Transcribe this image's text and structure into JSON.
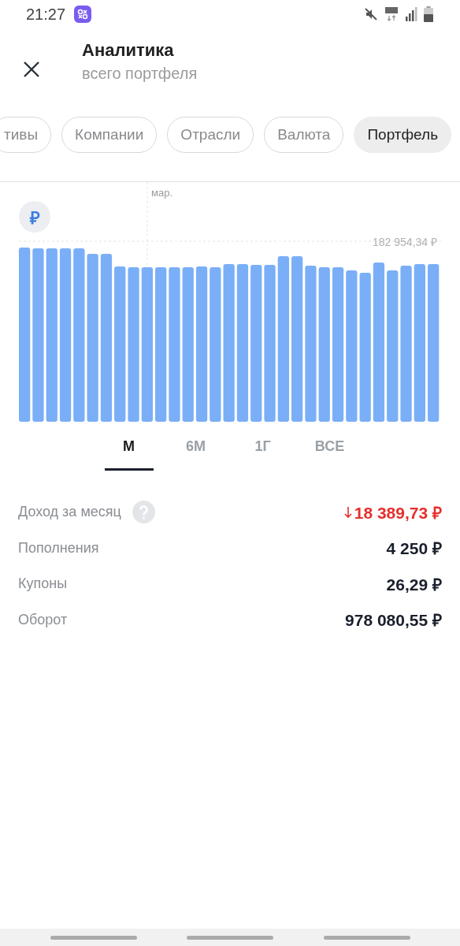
{
  "status_bar": {
    "time": "21:27"
  },
  "header": {
    "title": "Аналитика",
    "subtitle": "всего портфеля"
  },
  "filters": [
    {
      "label": "тивы",
      "selected": false
    },
    {
      "label": "Компании",
      "selected": false
    },
    {
      "label": "Отрасли",
      "selected": false
    },
    {
      "label": "Валюта",
      "selected": false
    },
    {
      "label": "Портфель",
      "selected": true
    }
  ],
  "chart": {
    "month_label": "мар.",
    "reference_value": "182 954,34 ₽",
    "currency_symbol": "₽"
  },
  "periods": [
    {
      "label": "М",
      "selected": true
    },
    {
      "label": "6М",
      "selected": false
    },
    {
      "label": "1Г",
      "selected": false
    },
    {
      "label": "ВСЕ",
      "selected": false
    }
  ],
  "stats": [
    {
      "label": "Доход за месяц",
      "value": "18 389,73 ₽",
      "kind": "loss",
      "help": true
    },
    {
      "label": "Пополнения",
      "value": "4 250 ₽",
      "kind": "plain",
      "help": false
    },
    {
      "label": "Купоны",
      "value": "26,29 ₽",
      "kind": "plain",
      "help": false
    },
    {
      "label": "Оборот",
      "value": "978 080,55 ₽",
      "kind": "plain",
      "help": false
    }
  ]
}
